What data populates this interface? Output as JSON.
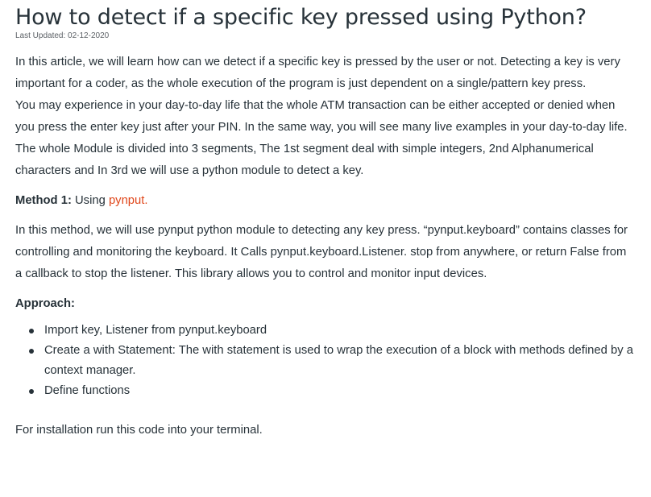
{
  "article": {
    "title": "How to detect if a specific key pressed using Python?",
    "last_updated": "Last Updated: 02-12-2020",
    "intro": [
      "In this article, we will learn how can we detect if a specific key is pressed by the user or not.  Detecting a key is very important for a coder, as the whole execution of the program is just dependent on a single/pattern key press.",
      "You may experience in your day-to-day life that the whole ATM transaction can be either accepted or denied when you press the enter key just after your PIN. In the same way, you will see many live examples in your day-to-day life.",
      "The whole Module is divided into 3 segments, The 1st segment deal with simple integers, 2nd Alphanumerical characters and In 3rd we will use a python module to detect a key."
    ],
    "method": {
      "label": "Method 1:",
      "using": " Using ",
      "link_text": "pynput."
    },
    "method_body": "In this method, we will use pynput python module to detecting any key press. “pynput.keyboard” contains classes for controlling and monitoring the keyboard. It Calls pynput.keyboard.Listener. stop from anywhere, or return False from a callback to stop the listener. This library allows you to control and monitor input devices.",
    "approach_label": "Approach:",
    "approach_steps": [
      "Import key, Listener from pynput.keyboard",
      "Create a with Statement: The with statement is used to wrap the execution of a block with methods defined by a context manager.",
      "Define functions"
    ],
    "install_text": "For installation run this code into your terminal."
  },
  "colors": {
    "text": "#273239",
    "link": "#e0461a",
    "muted": "#5c6166"
  }
}
